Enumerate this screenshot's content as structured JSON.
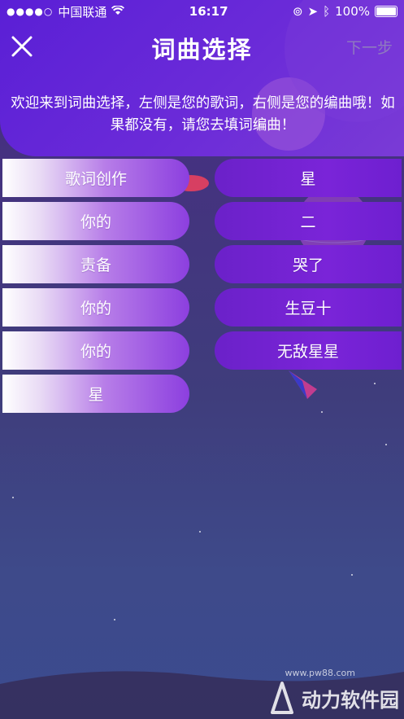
{
  "status": {
    "carrier": "中国联通",
    "time": "16:17",
    "battery": "100%"
  },
  "nav": {
    "title": "词曲选择",
    "next_label": "下一步"
  },
  "intro": "欢迎来到词曲选择，左侧是您的歌词，右侧是您的编曲哦！如果都没有，请您去填词编曲！",
  "lyrics": [
    "歌词创作",
    "你的",
    "责备",
    "你的",
    "你的",
    "星"
  ],
  "music": [
    "星",
    "二",
    "哭了",
    "生豆十",
    "无敌星星"
  ],
  "watermark": {
    "text": "动力软件园",
    "url": "www.pw88.com"
  },
  "colors": {
    "header": "#5a1fd6",
    "music_pill": "#6b21c9",
    "next_disabled": "#8f7bbf"
  }
}
